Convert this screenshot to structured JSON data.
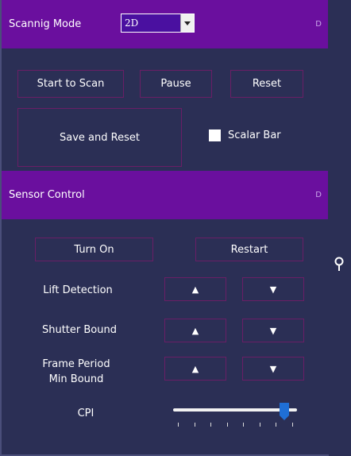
{
  "scan_panel": {
    "title": "Scannig Mode",
    "collapse_glyph": "D",
    "mode_select": {
      "value": "2D"
    },
    "buttons": {
      "start": "Start to Scan",
      "pause": "Pause",
      "reset": "Reset",
      "save_reset": "Save and Reset"
    },
    "scalar_bar": {
      "label": "Scalar Bar",
      "checked": false
    }
  },
  "sensor_panel": {
    "title": "Sensor Control",
    "collapse_glyph": "D",
    "buttons": {
      "turn_on": "Turn On",
      "restart": "Restart"
    },
    "rows": [
      {
        "label": "Lift Detection",
        "up": "▲",
        "down": "▼"
      },
      {
        "label": "Shutter Bound",
        "up": "▲",
        "down": "▼"
      },
      {
        "label_line1": "Frame Period",
        "label_line2": "Min Bound",
        "up": "▲",
        "down": "▼"
      }
    ],
    "cpi": {
      "label": "CPI",
      "value_fraction": 0.93,
      "tick_count": 8
    }
  },
  "colors": {
    "panel_bg": "#2b2f55",
    "header_bg": "#6a0f9e",
    "button_border": "#6a1e66",
    "slider_thumb": "#1f6fd6"
  },
  "icons": {
    "side_pin": "pin-icon"
  }
}
